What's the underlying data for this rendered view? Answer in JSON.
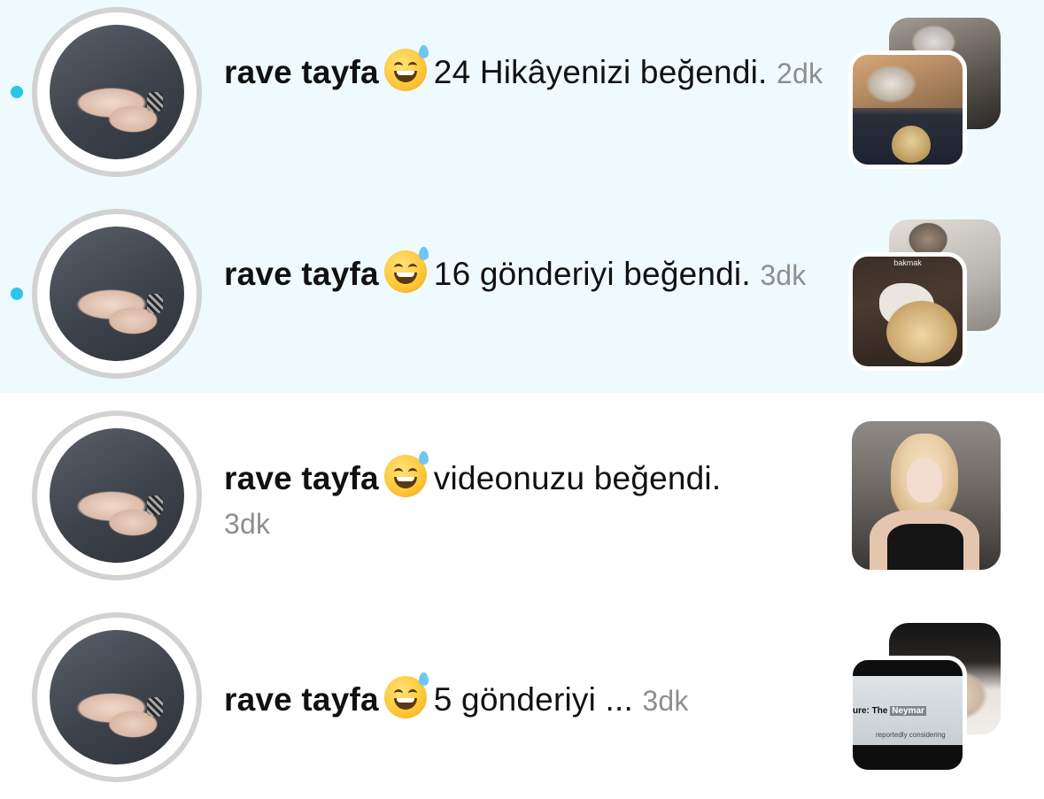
{
  "notifications": [
    {
      "unread": true,
      "username": "rave tayfa",
      "message": "24 Hikâyenizi beğendi.",
      "time": "2dk",
      "thumb_caption": ""
    },
    {
      "unread": true,
      "username": "rave tayfa",
      "message": "16 gönderiyi beğendi.",
      "time": "3dk",
      "thumb_caption": "bakmak"
    },
    {
      "unread": false,
      "username": "rave tayfa",
      "message": "videonuzu beğendi.",
      "time": "3dk"
    },
    {
      "unread": false,
      "username": "rave tayfa",
      "message": "5 gönderiyi ...",
      "time": "3dk",
      "thumb_caption_a": "ure: The",
      "thumb_caption_b": "Neymar",
      "thumb_caption_c": "reportedly considering"
    }
  ],
  "colors": {
    "unread_background": "#eefafd",
    "unread_dot": "#2cc4ea",
    "timestamp": "#8e8e8e"
  },
  "icons": {
    "emoji": "grinning-face-with-sweat-icon"
  }
}
